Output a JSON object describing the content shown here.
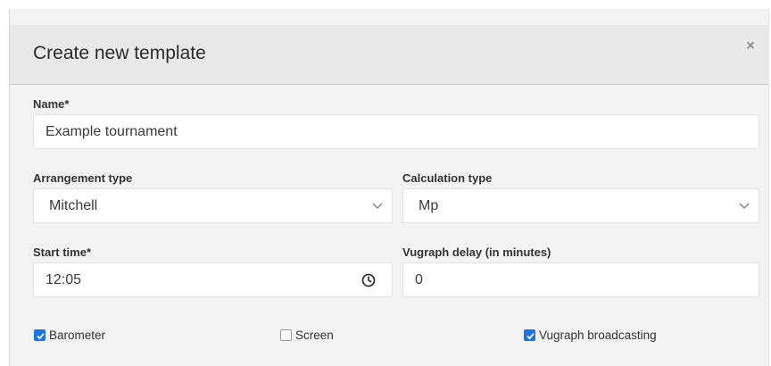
{
  "dialog": {
    "title": "Create new template",
    "close_glyph": "×"
  },
  "form": {
    "name": {
      "label": "Name*",
      "value": "Example tournament"
    },
    "arrangement_type": {
      "label": "Arrangement type",
      "selected": "Mitchell"
    },
    "calculation_type": {
      "label": "Calculation type",
      "selected": "Mp"
    },
    "start_time": {
      "label": "Start time*",
      "value": "12:05"
    },
    "vugraph_delay": {
      "label": "Vugraph delay (in minutes)",
      "value": "0"
    },
    "checkboxes": {
      "barometer": {
        "label": "Barometer",
        "checked": true
      },
      "screen": {
        "label": "Screen",
        "checked": false
      },
      "vugraph_broadcasting": {
        "label": "Vugraph broadcasting",
        "checked": true
      }
    }
  },
  "icons": {
    "close": "close-icon",
    "chevron": "chevron-down-icon",
    "clock": "clock-icon",
    "check": "check-icon"
  },
  "colors": {
    "accent": "#1a73e8",
    "header_bg": "#e8e9e8",
    "body_bg": "#f2f3f2"
  }
}
